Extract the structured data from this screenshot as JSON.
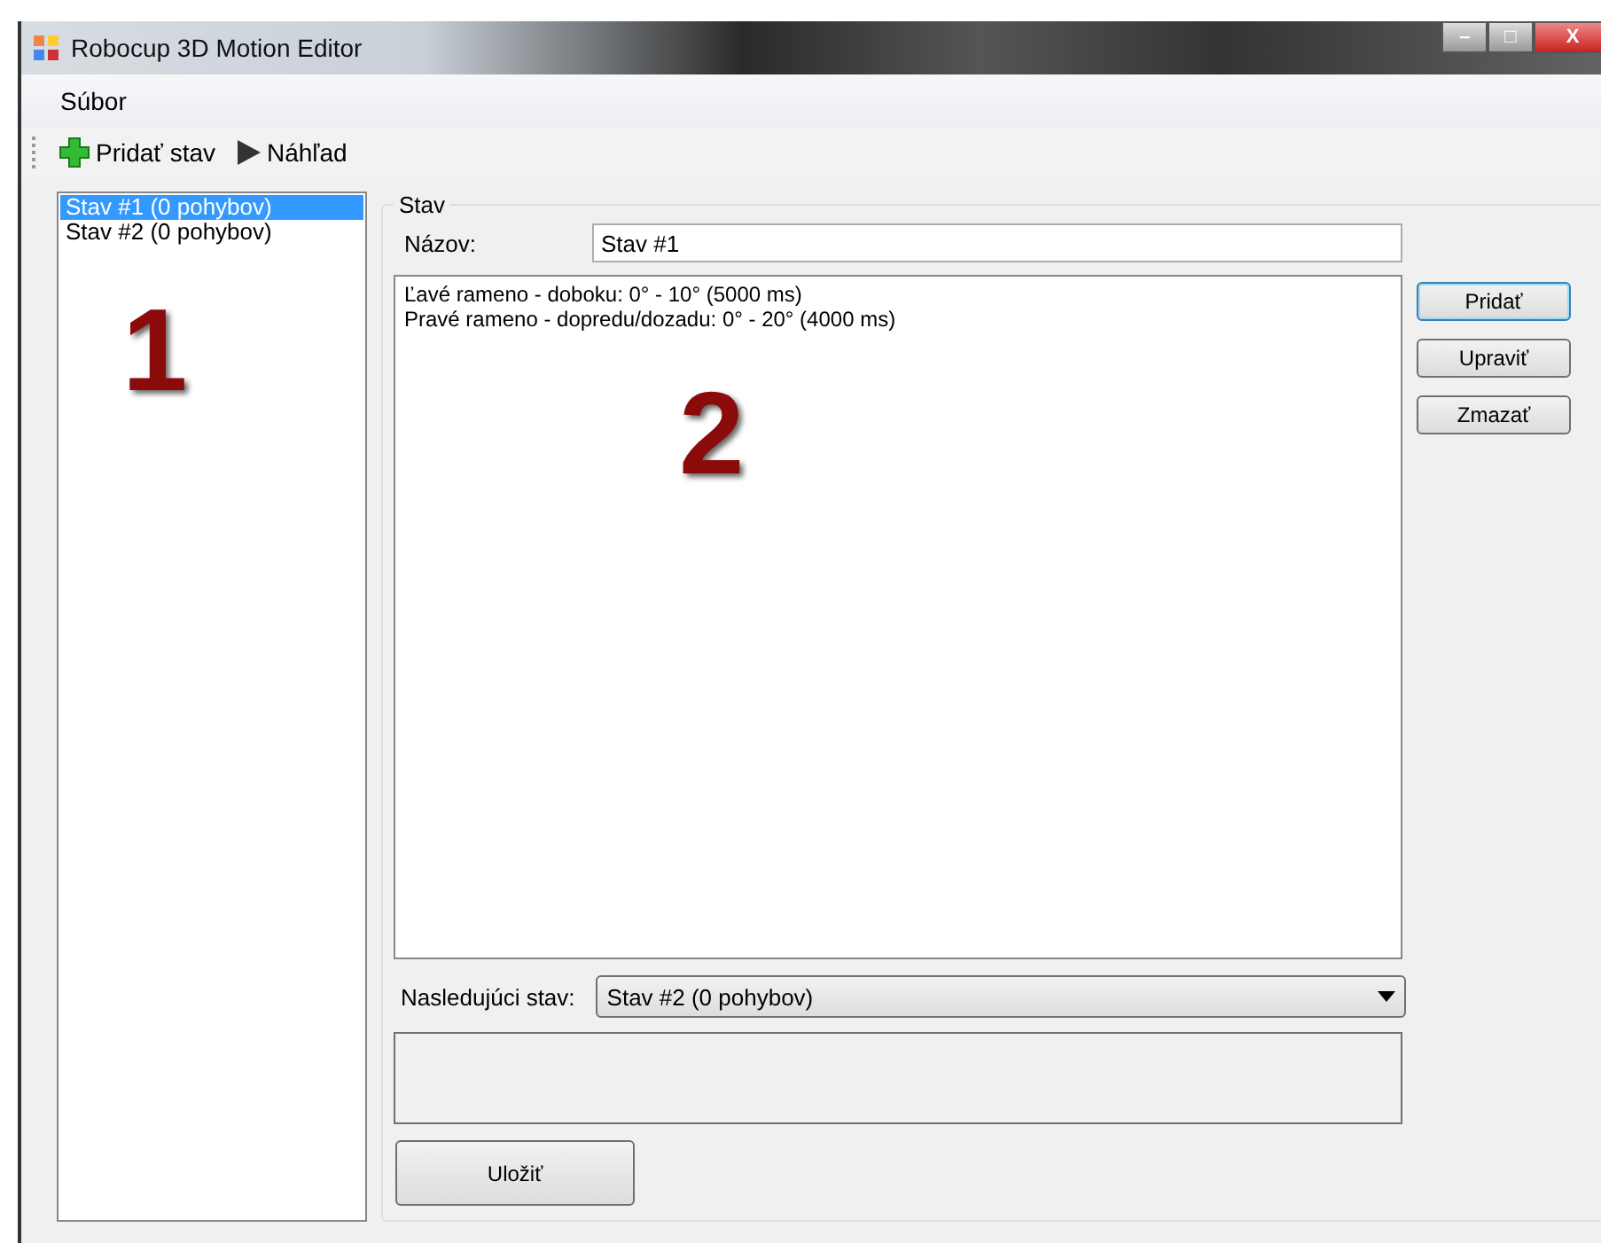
{
  "window": {
    "title": "Robocup 3D Motion Editor",
    "controls": [
      "–",
      "□",
      "X"
    ]
  },
  "menu": [
    "Súbor"
  ],
  "toolbar": [
    {
      "kind": "add",
      "label": "Pridať stav"
    },
    {
      "kind": "play",
      "label": "Náhľad"
    }
  ],
  "states_list": [
    {
      "label": "Stav #1 (0 pohybov)",
      "selected": true
    },
    {
      "label": "Stav #2 (0 pohybov)",
      "selected": false
    }
  ],
  "annotations": [
    "1",
    "2"
  ],
  "group": {
    "title": "Stav",
    "name_label": "Názov:",
    "name_value": "Stav #1",
    "motions": [
      "Ľavé rameno - doboku: 0° - 10° (5000 ms)",
      "Pravé rameno - dopredu/dozadu: 0° - 20° (4000 ms)"
    ],
    "side_buttons": [
      {
        "label": "Pridať",
        "focused": true
      },
      {
        "label": "Upraviť",
        "focused": false
      },
      {
        "label": "Zmazať",
        "focused": false
      }
    ],
    "next_label": "Nasledujúci stav:",
    "next_value": "Stav #2 (0 pohybov)",
    "save": "Uložiť"
  }
}
